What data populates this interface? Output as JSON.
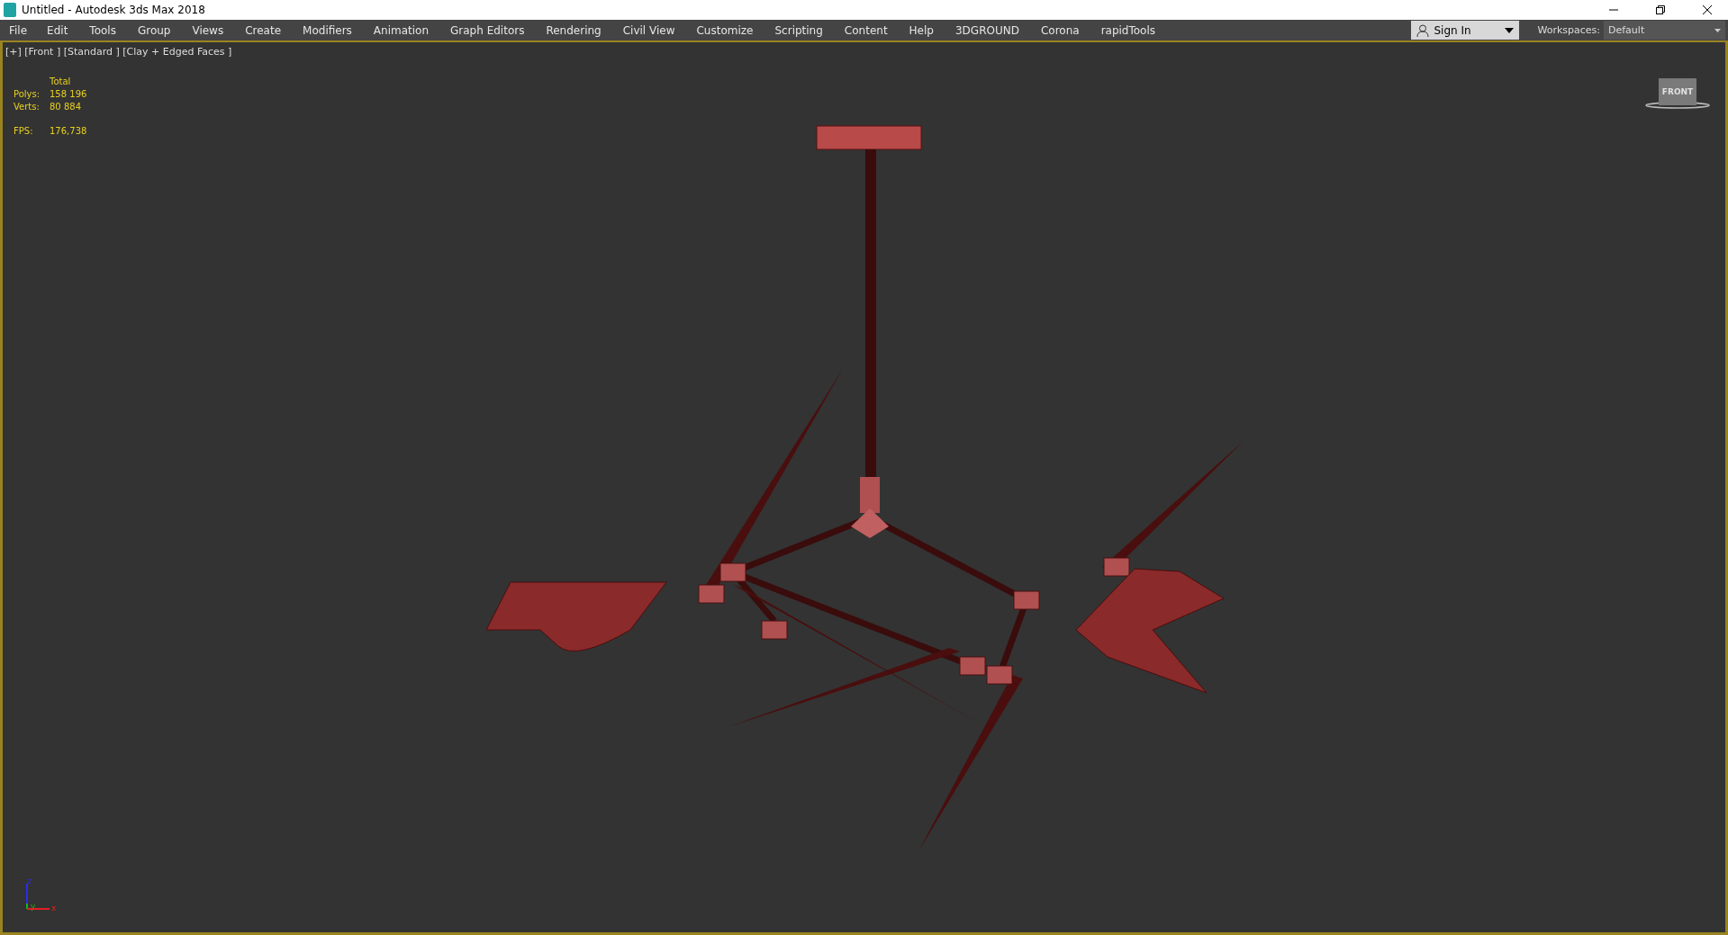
{
  "window": {
    "title": "Untitled - Autodesk 3ds Max 2018"
  },
  "menu": [
    "File",
    "Edit",
    "Tools",
    "Group",
    "Views",
    "Create",
    "Modifiers",
    "Animation",
    "Graph Editors",
    "Rendering",
    "Civil View",
    "Customize",
    "Scripting",
    "Content",
    "Help",
    "3DGROUND",
    "Corona",
    "rapidTools"
  ],
  "sign_in": {
    "label": "Sign In"
  },
  "workspaces": {
    "label": "Workspaces:",
    "value": "Default"
  },
  "viewport": {
    "label": "[+] [Front ] [Standard ] [Clay + Edged Faces ]",
    "stats": {
      "header": "Total",
      "rows": [
        {
          "label": "Polys:",
          "value": "158 196"
        },
        {
          "label": "Verts:",
          "value": "80 884"
        }
      ],
      "fps": {
        "label": "FPS:",
        "value": "176,738"
      }
    },
    "viewcube": {
      "label": "FRONT"
    },
    "axes": [
      {
        "label": "z",
        "color": "#2a2af0"
      },
      {
        "label": "y",
        "color": "#1fb01f"
      },
      {
        "label": "x",
        "color": "#e02020"
      }
    ]
  }
}
